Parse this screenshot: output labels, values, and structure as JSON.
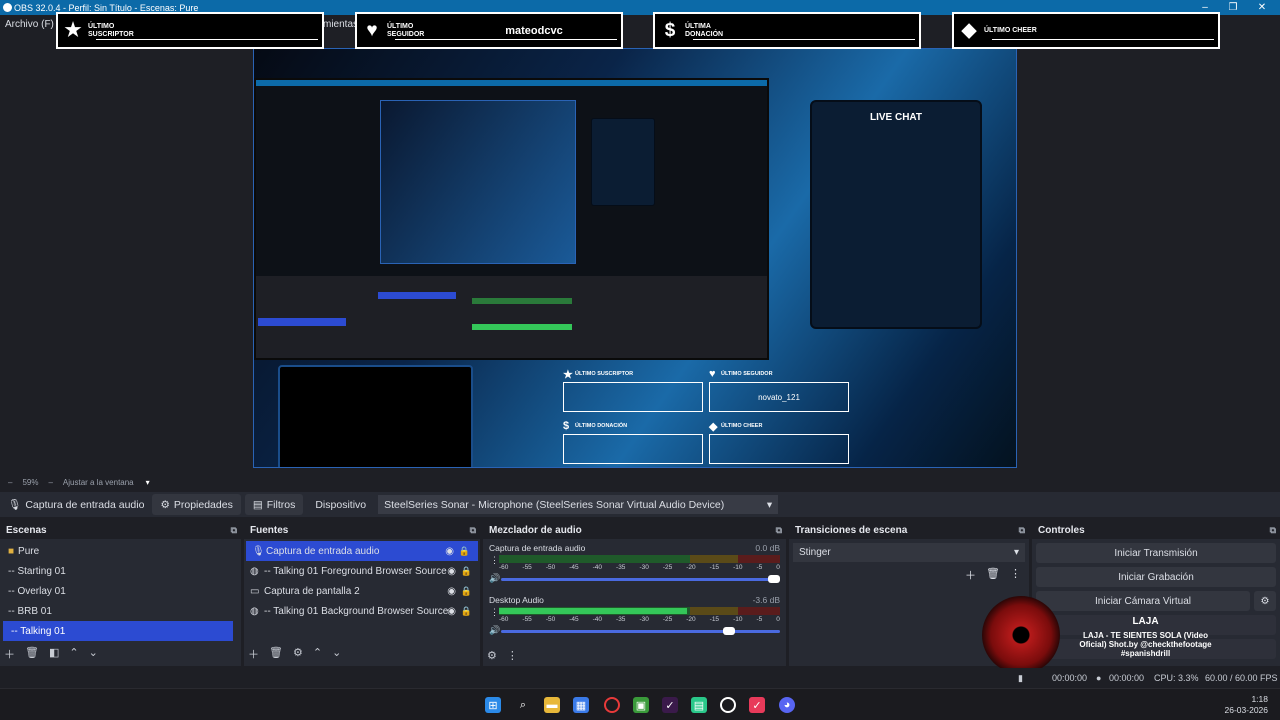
{
  "window": {
    "title": "OBS 32.0.4 - Perfil: Sin Título - Escenas: Pure"
  },
  "menu": {
    "items": [
      "Archivo (F)",
      "mientas"
    ]
  },
  "overlay": {
    "alerts": [
      {
        "label": "ÚLTIMO SUSCRIPTOR",
        "value": "",
        "icon": "★"
      },
      {
        "label": "ÚLTIMO SEGUIDOR",
        "value": "mateodcvc",
        "icon": "♥"
      },
      {
        "label": "ÚLTIMA DONACIÓN",
        "value": "",
        "icon": "$"
      },
      {
        "label": "ÚLTIMO CHEER",
        "value": "",
        "icon": "◆"
      }
    ],
    "live_chat": "LIVE CHAT",
    "small_alerts": [
      {
        "label": "ÚLTIMO SUSCRIPTOR",
        "value": "",
        "icon": "★"
      },
      {
        "label": "ÚLTIMO SEGUIDOR",
        "value": "novato_121",
        "icon": "♥"
      },
      {
        "label": "ÚLTIMO DONACIÓN",
        "value": "",
        "icon": "$"
      },
      {
        "label": "ÚLTIMO CHEER",
        "value": "",
        "icon": "◆"
      }
    ]
  },
  "preview": {
    "zoom": "59%",
    "fit": "Ajustar a la ventana"
  },
  "source_bar": {
    "source_name": "Captura de entrada audio",
    "properties": "Propiedades",
    "filters": "Filtros",
    "device_label": "Dispositivo",
    "device_value": "SteelSeries Sonar - Microphone (SteelSeries Sonar Virtual Audio Device)"
  },
  "scenes": {
    "title": "Escenas",
    "items": [
      "Pure",
      "-- Starting 01",
      "-- Overlay 01",
      "-- BRB 01",
      "-- Talking 01"
    ],
    "selected": "-- Talking 01"
  },
  "sources": {
    "title": "Fuentes",
    "items": [
      {
        "name": "Captura de entrada audio",
        "icon": "microphone-icon"
      },
      {
        "name": "-- Talking 01  Foreground Browser Source",
        "icon": "globe-icon"
      },
      {
        "name": "Captura de pantalla 2",
        "icon": "monitor-icon"
      },
      {
        "name": "-- Talking 01  Background Browser Source",
        "icon": "globe-icon"
      }
    ]
  },
  "mixer": {
    "title": "Mezclador de audio",
    "channels": [
      {
        "name": "Captura de entrada audio",
        "db": "0.0 dB",
        "level": 0.0,
        "volume": 1.0
      },
      {
        "name": "Desktop Audio",
        "db": "-3.6 dB",
        "level": 0.67,
        "volume": 0.84
      }
    ],
    "ticks": [
      "-60",
      "-55",
      "-50",
      "-45",
      "-40",
      "-35",
      "-30",
      "-25",
      "-20",
      "-15",
      "-10",
      "-5",
      "0"
    ]
  },
  "transitions": {
    "title": "Transiciones de escena",
    "selected": "Stinger"
  },
  "controls": {
    "title": "Controles",
    "buttons": [
      "Iniciar Transmisión",
      "Iniciar Grabación",
      "Iniciar Cámara Virtual"
    ]
  },
  "now_playing": {
    "title": "LAJA",
    "subtitle": "LAJA - TE SIENTES SOLA (Video Oficial) Shot.by @checkthefootage #spanishdrill"
  },
  "status": {
    "t1": "00:00:00",
    "t2": "00:00:00",
    "cpu": "CPU: 3.3%",
    "fps": "60.00 / 60.00 FPS"
  },
  "clock": {
    "time": "1:18",
    "date": "26-03-2026"
  },
  "colors": {
    "accent": "#2c4bd2",
    "titlebar": "#0c6aa8"
  }
}
